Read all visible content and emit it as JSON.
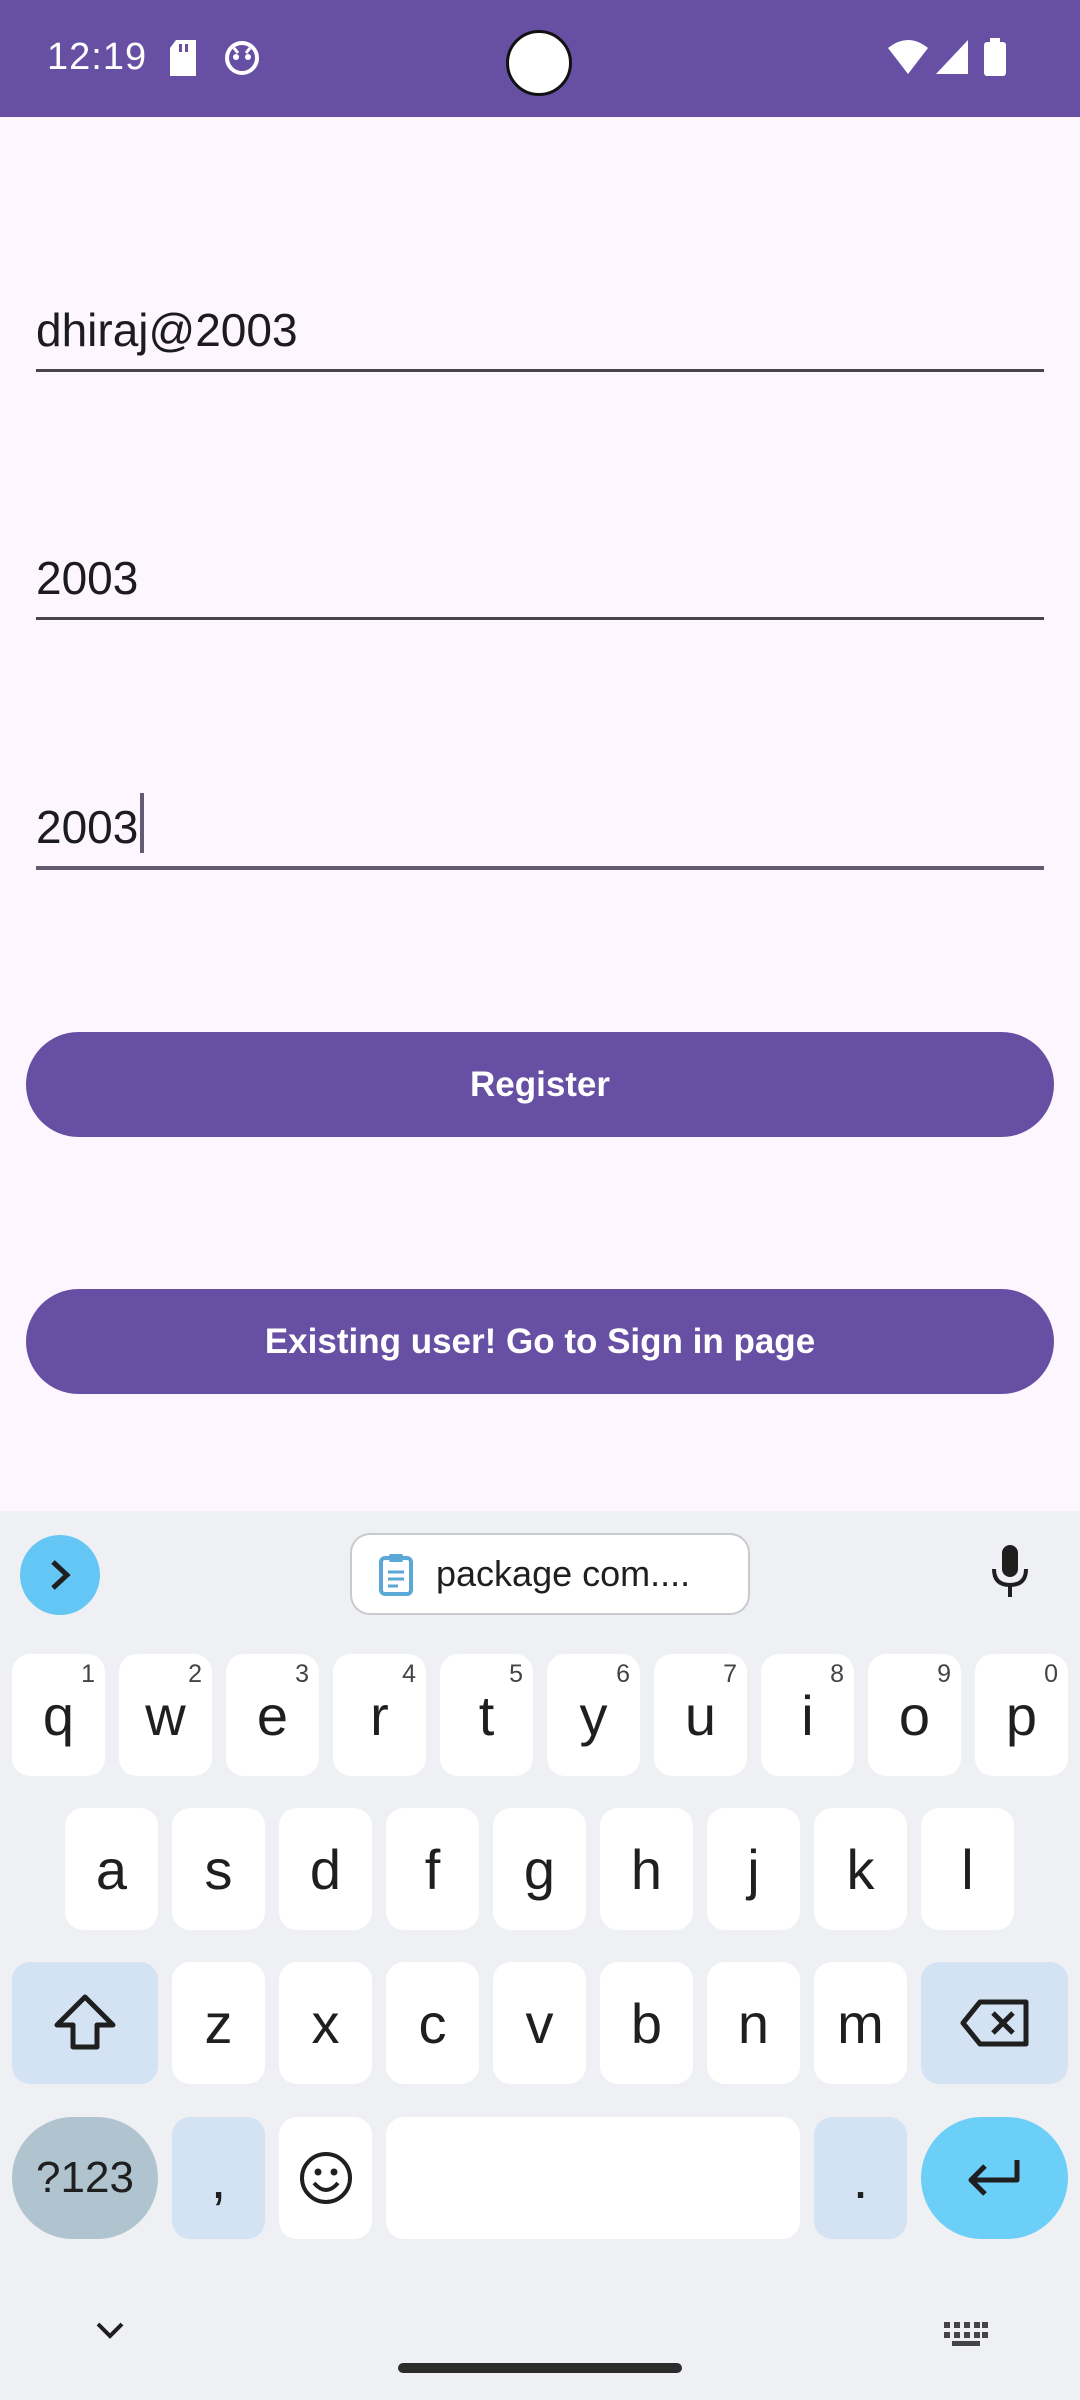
{
  "status_bar": {
    "time": "12:19"
  },
  "form": {
    "username_value": "dhiraj@2003",
    "password_value": "2003",
    "confirm_value": "2003",
    "register_label": "Register",
    "signin_label": "Existing user! Go to Sign in page"
  },
  "keyboard": {
    "clipboard_text": "package com....",
    "row1": [
      {
        "key": "q",
        "hint": "1"
      },
      {
        "key": "w",
        "hint": "2"
      },
      {
        "key": "e",
        "hint": "3"
      },
      {
        "key": "r",
        "hint": "4"
      },
      {
        "key": "t",
        "hint": "5"
      },
      {
        "key": "y",
        "hint": "6"
      },
      {
        "key": "u",
        "hint": "7"
      },
      {
        "key": "i",
        "hint": "8"
      },
      {
        "key": "o",
        "hint": "9"
      },
      {
        "key": "p",
        "hint": "0"
      }
    ],
    "row2": [
      "a",
      "s",
      "d",
      "f",
      "g",
      "h",
      "j",
      "k",
      "l"
    ],
    "row3": [
      "z",
      "x",
      "c",
      "v",
      "b",
      "n",
      "m"
    ],
    "symbols_label": "?123",
    "comma": ",",
    "period": "."
  },
  "colors": {
    "primary": "#6750a4",
    "background": "#fdf6fe",
    "keyboard_bg": "#eff0f3",
    "accent_blue": "#63c6f5"
  }
}
